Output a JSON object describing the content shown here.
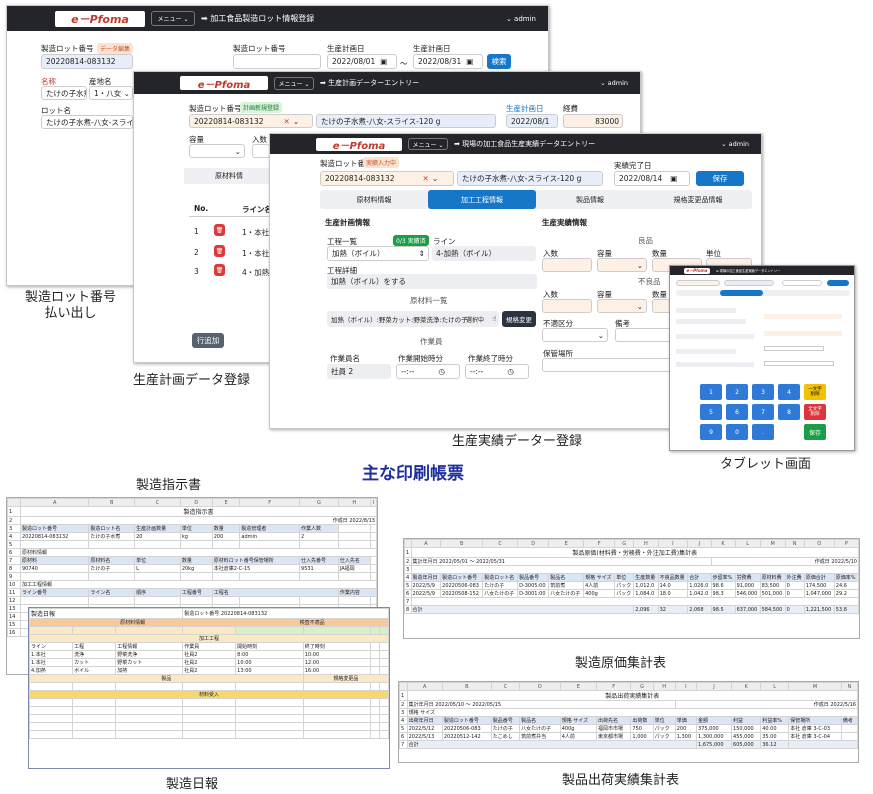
{
  "colors": {
    "nav_bg": "#24252a",
    "logo_red": "#c0392b",
    "primary": "#1677c9",
    "heading": "#1f2f9e"
  },
  "app": {
    "logo": "e－Pfoma",
    "menu": "メニュー ⌄",
    "admin": "⌄ admin"
  },
  "heading": "主な印刷帳票",
  "win1": {
    "title": "➡ 加工食品製造ロット情報登録",
    "lot_label": "製造ロット番号",
    "lot_badge": "データ編集",
    "lot_value": "20220814-083132",
    "name_label": "名称",
    "name_value": "たけの子水煮",
    "origin_label": "産地名",
    "origin_value": "1・八女 ⌄",
    "lot_name_label": "ロット名",
    "lot_name_value": "たけの子水煮-八女-スライス",
    "search_lot_label": "製造ロット番号",
    "plan_from_label": "生産計画日",
    "plan_from_value": "2022/08/01",
    "plan_to_label": "生産計画日",
    "plan_to_value": "2022/08/31",
    "tilde": "〜",
    "search_button": "検索",
    "caption": "製造ロット番号\n払い出し"
  },
  "win2": {
    "title": "➡ 生産計画データーエントリー",
    "lot_label": "製造ロット番号",
    "lot_badge": "計画新規登録",
    "lot_value": "20220814-083132",
    "product_value": "たけの子水煮-八女-スライス-120 g",
    "plan_date_label": "生産計画日",
    "plan_date_value": "2022/08/1",
    "cost_label": "経費",
    "cost_value": "83000",
    "qty_label": "容量",
    "unit_label": "入数",
    "tab_label": "原材料情",
    "table_header_no": "No.",
    "table_header_line": "ライン名",
    "rows": [
      {
        "no": "1",
        "line": "1・本社"
      },
      {
        "no": "2",
        "line": "1・本社"
      },
      {
        "no": "3",
        "line": "4・加熱"
      }
    ],
    "add_row_button": "行追加",
    "caption": "生産計画データ登録"
  },
  "win3": {
    "title": "➡ 現場の加工食品生産実績データエントリー",
    "lot_label": "製造ロット番号",
    "lot_badge": "実績入力中",
    "lot_value": "20220814-083132",
    "product_value": "たけの子水煮-八女-スライス-120 g",
    "done_label": "実績完了日",
    "done_value": "2022/08/14",
    "save_button": "保存",
    "tabs": [
      "原材料情報",
      "加工工程情報",
      "製品情報",
      "規格変更品情報"
    ],
    "plan_section": "生産計画情報",
    "process_list_label": "工程一覧",
    "process_badge": "0/3 実績済",
    "line_label": "ライン",
    "process_value": "加熱（ボイル）",
    "line_value": "4-加熱（ボイル）",
    "process_detail_label": "工程詳細",
    "process_detail_value": "加熱（ボイル）をする",
    "material_section": "原材料一覧",
    "material_value": "加熱（ボイル）:野菜カット:野菜洗浄:たけの子",
    "selecting": "選択中",
    "spec_change_button": "規格変更",
    "worker_section": "作業員",
    "worker_name_label": "作業員名",
    "start_label": "作業開始時分",
    "end_label": "作業終了時分",
    "worker_value": "社員 2",
    "time_placeholder": "--:--",
    "result_section": "生産実績情報",
    "good_label": "良品",
    "defect_label": "不良品",
    "count_label": "入数",
    "volume_label": "容量",
    "quantity_label": "数量",
    "unit_label": "単位",
    "defect_class_label": "不適区分",
    "remarks_label": "備考",
    "storage_label": "保管場所",
    "caption": "生産実績データー登録"
  },
  "tablet": {
    "title": "➡ 現場の加工食品生産実績データエントリー",
    "keys": [
      "1",
      "2",
      "3",
      "4",
      "5",
      "6",
      "7",
      "8",
      "9",
      "0",
      "."
    ],
    "key_one": "一文字\n削除",
    "key_all": "全文字\n削除",
    "key_save": "保存",
    "caption": "タブレット画面"
  },
  "sheet_instruction": {
    "caption": "製造指示書",
    "title": "製造指示書",
    "created": "作成日 2022/8/13",
    "headers": [
      "製造ロット番号",
      "製造ロット名",
      "生産計画数量",
      "単位",
      "数量",
      "製造管理者",
      "作業人数"
    ],
    "row": [
      "20220814-083132",
      "たけの子水煮",
      "20",
      "kg",
      "200",
      "admin",
      "2"
    ],
    "material_title": "原材料情報",
    "material_headers": [
      "原材料",
      "原材料名",
      "単位",
      "数量",
      "原材料ロット番号保管場所",
      "仕入先番号",
      "仕入先名"
    ],
    "material_row": [
      "90740",
      "たけの子",
      "L",
      "20kg",
      "本社倉庫2-C-15",
      "9531",
      "JA福岡"
    ],
    "process_title": "加工工程情報",
    "process_headers": [
      "ライン番号",
      "ライン名",
      "順序",
      "工程番号",
      "工程名",
      "作業内容"
    ]
  },
  "sheet_daily": {
    "caption": "製造日報",
    "title": "製造日報",
    "lot": "製造ロット番号 20220814-083132",
    "section_material": "原材料情報",
    "section_inspection": "検査不適品",
    "section_process": "加工工程",
    "section_product": "製品",
    "section_spec": "規格変更品",
    "section_material_in": "材料受入",
    "row_a": [
      "ライン",
      "工程",
      "工程情報",
      "作業員",
      "開始時刻",
      "終了時刻"
    ],
    "row_b": [
      "1.本社",
      "洗浄",
      "野菜洗浄",
      "社員2",
      "8:00",
      "10:00"
    ],
    "row_c": [
      "1.本社",
      "カット",
      "野菜カット",
      "社員2",
      "10:00",
      "12:00"
    ],
    "row_d": [
      "4.加熱",
      "ボイル",
      "加熱",
      "社員2",
      "13:00",
      "16:00"
    ]
  },
  "sheet_cost": {
    "caption": "製造原価集計表",
    "title": "製品原価(材料費・労務費・外注加工費)集計表",
    "period": "集計年月日  2022/05/01 〜 2022/05/31",
    "created": "作成日 2022/5/10",
    "headers": [
      "製造年月日",
      "製造ロット番号",
      "製造ロット名",
      "製品番号",
      "製品名",
      "規格 サイズ",
      "単位",
      "生産数量",
      "不良品数量",
      "合計",
      "歩留率%",
      "労務費",
      "原材料費",
      "外注費",
      "原価合計",
      "原価率%"
    ],
    "rows": [
      [
        "2022/5/9",
        "20220506-083",
        "たけの子",
        "D-3005:00",
        "筑前煮",
        "4人前",
        "パック",
        "1,012.0",
        "14.0",
        "1,026.0",
        "98.6",
        "91,000",
        "83,500",
        "0",
        "174,500",
        "24.6"
      ],
      [
        "2022/5/9",
        "20220508-152",
        "八女たけの子",
        "D-3001:00",
        "八女たけの子",
        "400g",
        "パック",
        "1,084.0",
        "18.0",
        "1,042.0",
        "98.3",
        "546,000",
        "501,000",
        "0",
        "1,047,000",
        "29.2"
      ]
    ],
    "total_label": "合計",
    "totals": [
      "2,096",
      "32",
      "2,068",
      "98.5",
      "637,000",
      "584,500",
      "0",
      "1,221,500",
      "53.8"
    ]
  },
  "sheet_shipping": {
    "caption": "製品出荷実績集計表",
    "title": "製品出荷実績集計表",
    "period": "集計年月日  2022/05/10 〜 2022/05/15",
    "created": "作成日 2022/5/16",
    "sub": "規格  サイズ",
    "headers": [
      "出荷年月日",
      "製造ロット番号",
      "製品番号",
      "製品名",
      "規格 サイズ",
      "出荷先名",
      "出荷数",
      "単位",
      "単価",
      "金額",
      "利益",
      "利益率%",
      "保管場所",
      "備考"
    ],
    "rows": [
      [
        "2022/5/12",
        "20220506-083",
        "たけの子",
        "八女たけの子",
        "400g",
        "福岡市市場",
        "750",
        "パック",
        "200",
        "375,000",
        "150,000",
        "40.00",
        "本社 倉庫 3-C-03",
        ""
      ],
      [
        "2022/5/13",
        "20220512-142",
        "たこめし",
        "筑前煮弁当",
        "4人前",
        "東京都市場",
        "1,000",
        "パック",
        "1,300",
        "1,300,000",
        "455,000",
        "35.00",
        "本社 倉庫 3-C-04",
        ""
      ]
    ],
    "total_label": "合計",
    "totals": [
      "1,675,000",
      "605,000",
      "36.12"
    ]
  }
}
